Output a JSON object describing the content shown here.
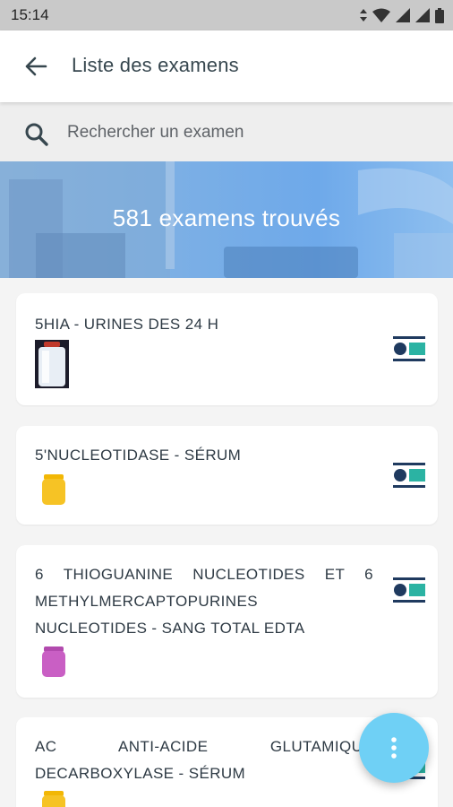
{
  "status_bar": {
    "time": "15:14"
  },
  "header": {
    "title": "Liste des examens"
  },
  "search": {
    "placeholder": "Rechercher un examen"
  },
  "banner": {
    "count_text": "581 examens trouvés"
  },
  "exams": [
    {
      "title": "5HIA - URINES DES 24 H",
      "container": "urine-24h-container-icon"
    },
    {
      "title": "5'NUCLEOTIDASE - SÉRUM",
      "container": "yellow-tube-icon"
    },
    {
      "title": "6 THIOGUANINE NUCLEOTIDES ET 6 METHYLMERCAPTOPURINES NUCLEOTIDES - SANG TOTAL EDTA",
      "container": "purple-tube-icon"
    },
    {
      "title": "AC ANTI-ACIDE GLUTAMIQUE DECARBOXYLASE - SÉRUM",
      "container": "yellow-tube-icon"
    }
  ],
  "colors": {
    "accent": "#6fd0f5",
    "info_icon_dark": "#1f3a5f",
    "info_icon_teal": "#2bb3a3",
    "yellow_tube": "#f6c325",
    "purple_tube": "#c95fc4"
  },
  "fab": {
    "icon": "more-vertical-icon"
  }
}
